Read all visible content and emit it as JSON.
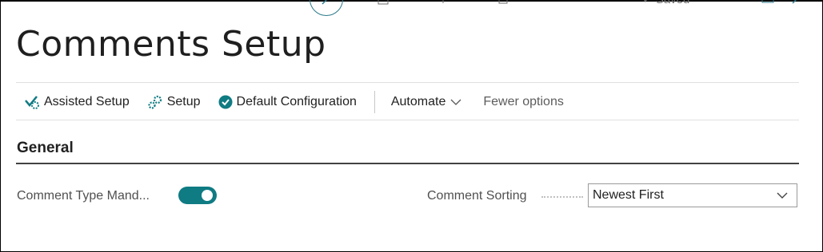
{
  "page": {
    "title": "Comments Setup"
  },
  "top": {
    "saved_label": "Saved"
  },
  "actions": {
    "assisted_setup": "Assisted Setup",
    "setup": "Setup",
    "default_configuration": "Default Configuration",
    "automate": "Automate",
    "fewer_options": "Fewer options"
  },
  "general": {
    "heading": "General",
    "comment_type_mandatory_label": "Comment Type Mand...",
    "comment_type_mandatory_value": true,
    "comment_sorting_label": "Comment Sorting",
    "comment_sorting_value": "Newest First"
  },
  "colors": {
    "accent": "#0f7b83",
    "text": "#212121"
  },
  "icons": [
    "edit-icon",
    "assisted-setup-icon",
    "setup-icon",
    "check-circle-icon",
    "chevron-down-icon",
    "bookmark-icon",
    "collapse-icon"
  ]
}
